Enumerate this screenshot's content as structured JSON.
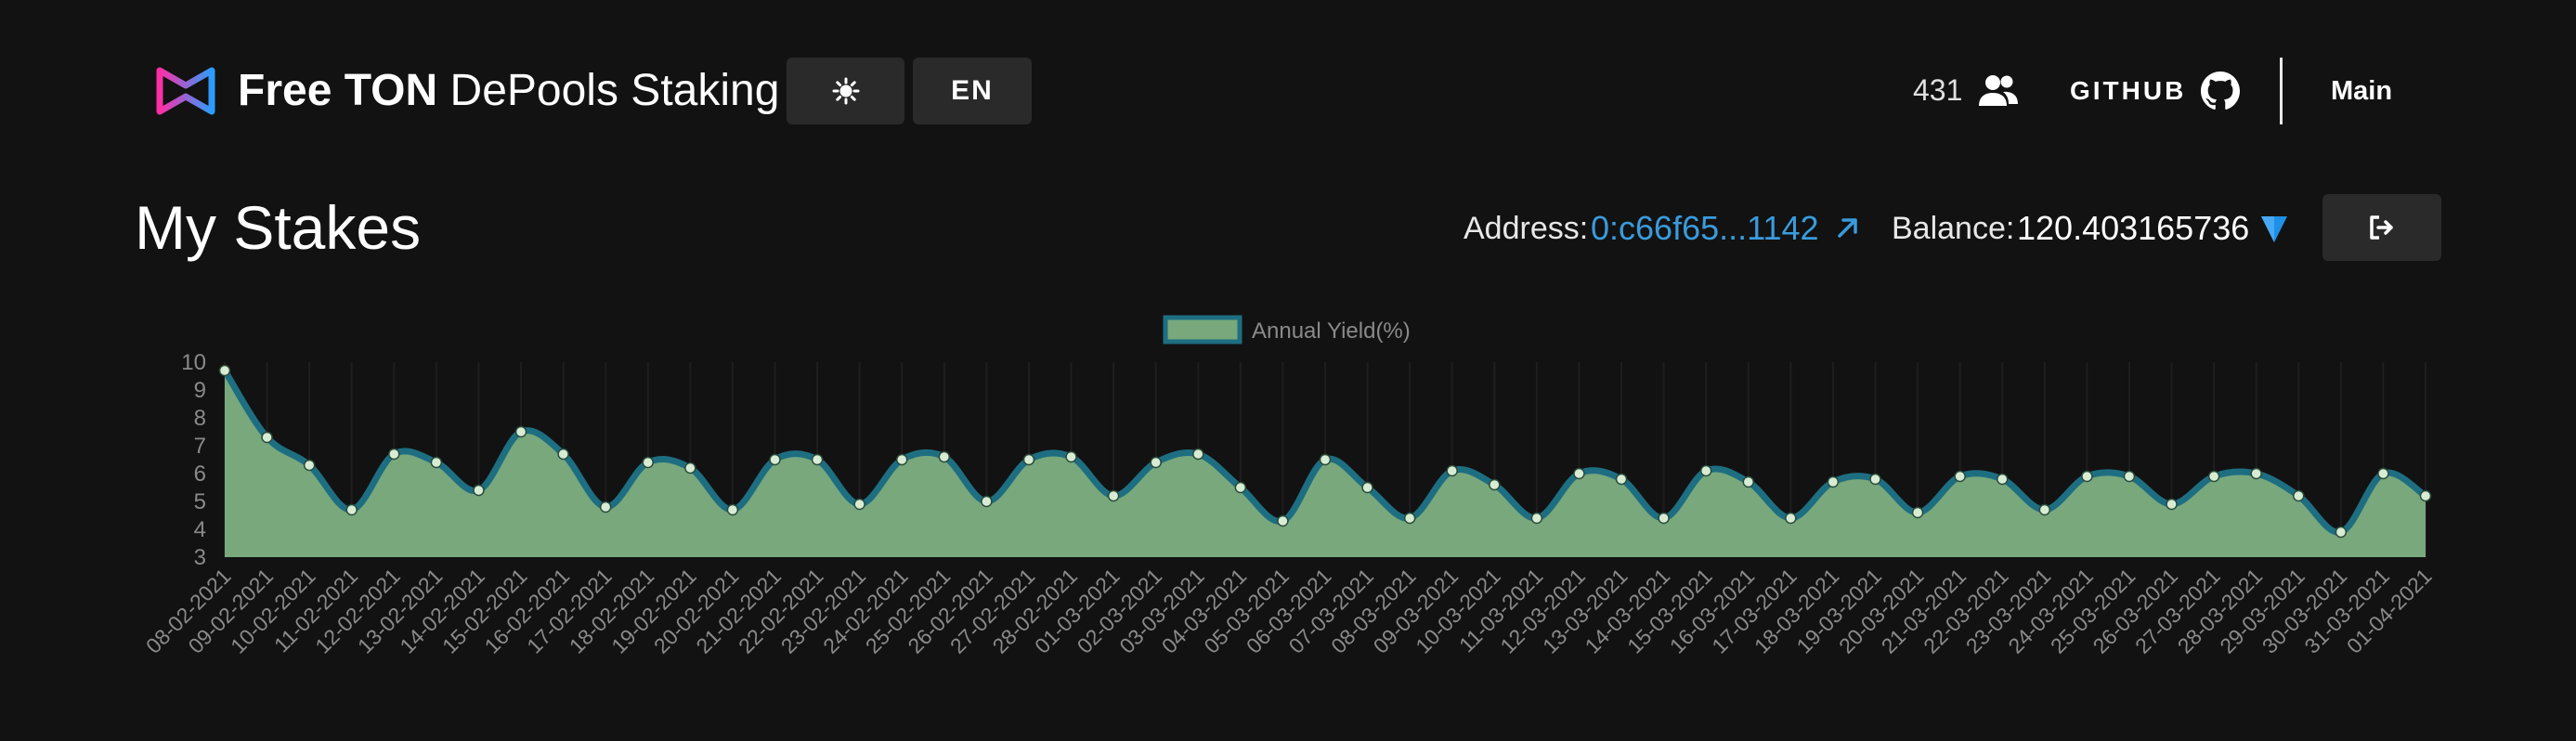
{
  "header": {
    "brand_bold": "Free TON",
    "brand_rest": "DePools Staking",
    "theme_icon": "sun-icon",
    "lang_label": "EN",
    "users_count": "431",
    "github_label": "GITHUB",
    "main_label": "Main"
  },
  "page": {
    "title": "My Stakes",
    "address_label": "Address:",
    "address_value": "0:c66f65...1142",
    "balance_label": "Balance:",
    "balance_value": "120.403165736"
  },
  "colors": {
    "background": "#121212",
    "button": "#2a2a2a",
    "link": "#3a9bdc",
    "area_fill": "#78a87c",
    "area_line": "#1e6e82",
    "point_fill": "#d8ecd4"
  },
  "chart_data": {
    "type": "area",
    "title": "",
    "xlabel": "",
    "ylabel": "",
    "ylim": [
      3,
      10
    ],
    "yticks": [
      10,
      9,
      8,
      7,
      6,
      5,
      4,
      3
    ],
    "legend": "top-center",
    "grid": true,
    "x": [
      "08-02-2021",
      "09-02-2021",
      "10-02-2021",
      "11-02-2021",
      "12-02-2021",
      "13-02-2021",
      "14-02-2021",
      "15-02-2021",
      "16-02-2021",
      "17-02-2021",
      "18-02-2021",
      "19-02-2021",
      "20-02-2021",
      "21-02-2021",
      "22-02-2021",
      "23-02-2021",
      "24-02-2021",
      "25-02-2021",
      "26-02-2021",
      "27-02-2021",
      "28-02-2021",
      "01-03-2021",
      "02-03-2021",
      "03-03-2021",
      "04-03-2021",
      "05-03-2021",
      "06-03-2021",
      "07-03-2021",
      "08-03-2021",
      "09-03-2021",
      "10-03-2021",
      "11-03-2021",
      "12-03-2021",
      "13-03-2021",
      "14-03-2021",
      "15-03-2021",
      "16-03-2021",
      "17-03-2021",
      "18-03-2021",
      "19-03-2021",
      "20-03-2021",
      "21-03-2021",
      "22-03-2021",
      "23-03-2021",
      "24-03-2021",
      "25-03-2021",
      "26-03-2021",
      "27-03-2021",
      "28-03-2021",
      "29-03-2021",
      "30-03-2021",
      "31-03-2021",
      "01-04-2021"
    ],
    "series": [
      {
        "name": "Annual Yield(%)",
        "values": [
          9.7,
          7.3,
          6.3,
          4.7,
          6.7,
          6.4,
          5.4,
          7.5,
          6.7,
          4.8,
          6.4,
          6.2,
          4.7,
          6.5,
          6.5,
          4.9,
          6.5,
          6.6,
          5.0,
          6.5,
          6.6,
          5.2,
          6.4,
          6.7,
          5.5,
          4.3,
          6.5,
          5.5,
          4.4,
          6.1,
          5.6,
          4.4,
          6.0,
          5.8,
          4.4,
          6.1,
          5.7,
          4.4,
          5.7,
          5.8,
          4.6,
          5.9,
          5.8,
          4.7,
          5.9,
          5.9,
          4.9,
          5.9,
          6.0,
          5.2,
          3.9,
          6.0,
          5.2
        ]
      }
    ]
  }
}
